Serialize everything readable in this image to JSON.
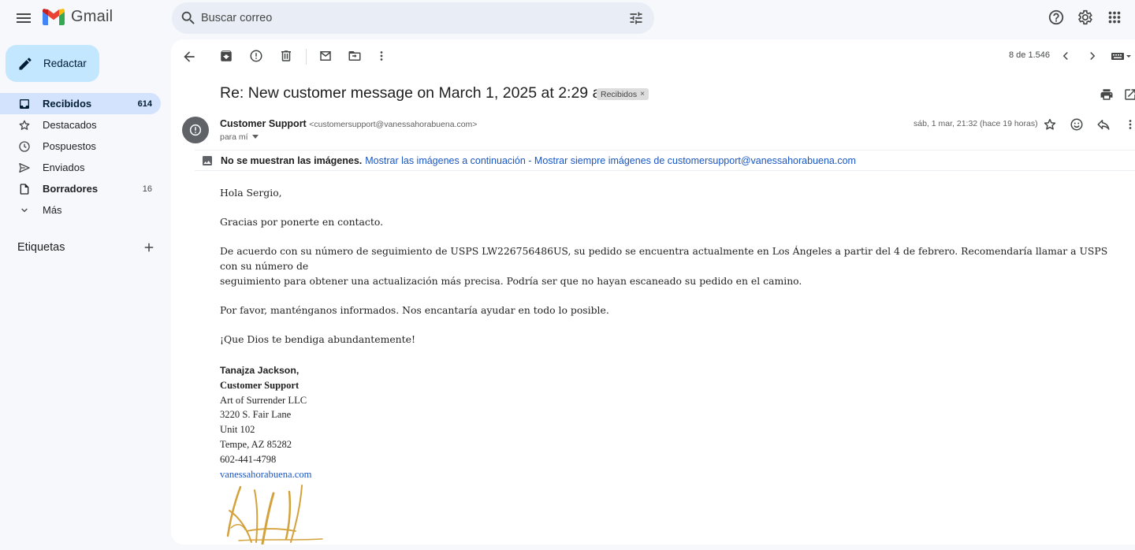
{
  "app": {
    "name": "Gmail"
  },
  "search": {
    "placeholder": "Buscar correo"
  },
  "sidebar": {
    "compose_label": "Redactar",
    "items": [
      {
        "label": "Recibidos",
        "count": "614",
        "icon": "inbox-icon",
        "active": true
      },
      {
        "label": "Destacados",
        "count": "",
        "icon": "star-icon"
      },
      {
        "label": "Pospuestos",
        "count": "",
        "icon": "clock-icon"
      },
      {
        "label": "Enviados",
        "count": "",
        "icon": "send-icon"
      },
      {
        "label": "Borradores",
        "count": "16",
        "icon": "draft-icon"
      },
      {
        "label": "Más",
        "count": "",
        "icon": "chevron-down-icon"
      }
    ],
    "labels_title": "Etiquetas"
  },
  "toolbar": {
    "pager": "8 de 1.546"
  },
  "message": {
    "subject": "Re: New customer message on March 1, 2025 at 2:29 am",
    "label_chip": "Recibidos",
    "label_chip_close": "×",
    "sender_name": "Customer Support",
    "sender_email": "<customersupport@vanessahorabuena.com>",
    "to": "para mí",
    "date": "sáb, 1 mar, 21:32 (hace 19 horas)",
    "images_warning": "No se muestran las imágenes.",
    "images_link": "Mostrar las imágenes a continuación - Mostrar siempre imágenes de customersupport@vanessahorabuena.com",
    "body": {
      "greeting": "Hola Sergio,",
      "p1": "Gracias por ponerte en contacto.",
      "p2_line1": "De acuerdo con su número de seguimiento de USPS LW226756486US, su pedido se encuentra actualmente en Los Ángeles a partir del 4 de febrero. Recomendaría llamar a USPS con su número de",
      "p2_line2": "seguimiento para obtener una actualización más precisa. Podría ser que no hayan escaneado su pedido en el camino.",
      "p3": "Por favor, manténganos informados. Nos encantaría ayudar en todo lo posible.",
      "p4": "¡Que Dios te bendiga abundantemente!"
    },
    "signature": {
      "name": "Tanajza Jackson,",
      "title": "Customer Support",
      "company": "Art of Surrender LLC",
      "address1": "3220 S. Fair Lane",
      "address2": "Unit 102",
      "city": "Tempe, AZ 85282",
      "phone": "602-441-4798",
      "website": "vanessahorabuena.com"
    }
  },
  "colors": {
    "compose_bg": "#c2e7ff",
    "active_nav_bg": "#d3e3fd",
    "search_bg": "#e9eef6",
    "link": "#1a57c4",
    "signature_ink": "#d4a23c"
  }
}
